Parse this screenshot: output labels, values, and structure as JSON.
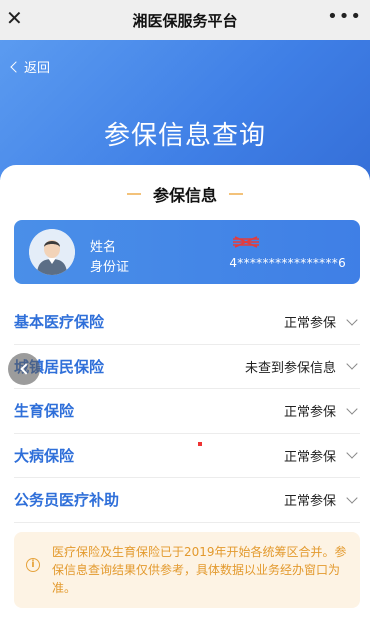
{
  "topbar": {
    "close": "✕",
    "title": "湘医保服务平台",
    "more": "•••"
  },
  "hero": {
    "back_label": "返回",
    "title": "参保信息查询"
  },
  "section": {
    "title": "参保信息"
  },
  "person": {
    "name_label": "姓名",
    "id_label": "身份证",
    "id_value": "4****************6"
  },
  "insurances": [
    {
      "name": "基本医疗保险",
      "status": "正常参保"
    },
    {
      "name": "城镇居民保险",
      "status": "未查到参保信息"
    },
    {
      "name": "生育保险",
      "status": "正常参保"
    },
    {
      "name": "大病保险",
      "status": "正常参保"
    },
    {
      "name": "公务员医疗补助",
      "status": "正常参保"
    }
  ],
  "notice": {
    "text": "医疗保险及生育保险已于2019年开始各统筹区合并。参保信息查询结果仅供参考，具体数据以业务经办窗口为准。"
  },
  "colors": {
    "primary": "#3f7fe6",
    "accent": "#2f6fd9",
    "notice_bg": "#fdf3e4",
    "notice_text": "#e39a2e"
  }
}
